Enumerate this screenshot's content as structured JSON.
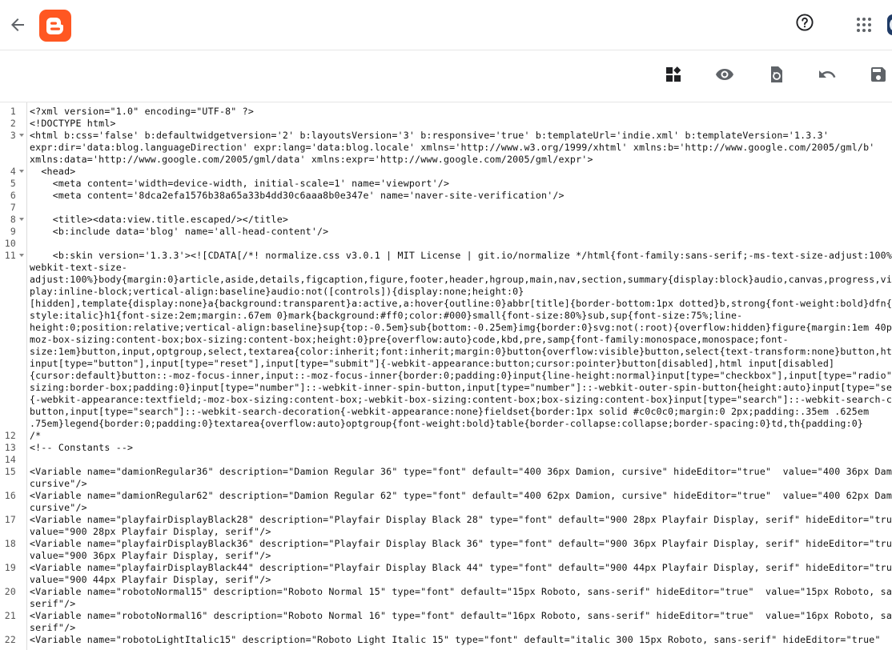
{
  "header": {
    "back_icon": "arrow-left-icon",
    "logo_icon": "blogger-logo",
    "help_icon": "help-circle-icon",
    "apps_icon": "apps-grid-icon",
    "account_icon": "account-avatar"
  },
  "toolbar": {
    "buttons": [
      "widgets-jump-icon",
      "preview-eye-icon",
      "restore-template-icon",
      "undo-icon",
      "save-icon"
    ]
  },
  "colors": {
    "brand": "#ff5722",
    "string": "#a31515",
    "text": "#111111",
    "gutter_text": "#555555"
  },
  "editor": {
    "line_numbers": [
      "1",
      "2",
      "3",
      "",
      "",
      "4",
      "5",
      "6",
      "7",
      "8",
      "9",
      "10",
      "11",
      "",
      "",
      "",
      "",
      "",
      "",
      "",
      "",
      "",
      "",
      "",
      "",
      "",
      "",
      "12",
      "13",
      "14",
      "15",
      "",
      "16",
      "",
      "17",
      "",
      "18",
      "",
      "19",
      "",
      "20",
      "",
      "21",
      "",
      "22"
    ],
    "lines": [
      "<?xml version=\"1.0\" encoding=\"UTF-8\" ?>",
      "<!DOCTYPE html>",
      "<html b:css='false' b:defaultwidgetversion='2' b:layoutsVersion='3' b:responsive='true' b:templateUrl='indie.xml' b:templateVersion='1.3.3'",
      "expr:dir='data:blog.languageDirection' expr:lang='data:blog.locale' xmlns='http://www.w3.org/1999/xhtml' xmlns:b='http://www.google.com/2005/gml/b'",
      "xmlns:data='http://www.google.com/2005/gml/data' xmlns:expr='http://www.google.com/2005/gml/expr'>",
      "  <head>",
      "    <meta content='width=device-width, initial-scale=1' name='viewport'/>",
      "    <meta content='8dca2efa1576b38a65a33b4dd30c6aaa8b0e347e' name='naver-site-verification'/>",
      "",
      "    <title><data:view.title.escaped/></title>",
      "    <b:include data='blog' name='all-head-content'/>",
      "",
      "    <b:skin version='1.3.3'><![CDATA[/*! normalize.css v3.0.1 | MIT License | git.io/normalize */html{font-family:sans-serif;-ms-text-size-adjust:100%;-",
      "webkit-text-size-",
      "adjust:100%}body{margin:0}article,aside,details,figcaption,figure,footer,header,hgroup,main,nav,section,summary{display:block}audio,canvas,progress,video{",
      "play:inline-block;vertical-align:baseline}audio:not([controls]){display:none;height:0}",
      "[hidden],template{display:none}a{background:transparent}a:active,a:hover{outline:0}abbr[title]{border-bottom:1px dotted}b,strong{font-weight:bold}dfn{font",
      "style:italic}h1{font-size:2em;margin:.67em 0}mark{background:#ff0;color:#000}small{font-size:80%}sub,sup{font-size:75%;line-",
      "height:0;position:relative;vertical-align:baseline}sup{top:-0.5em}sub{bottom:-0.25em}img{border:0}svg:not(:root){overflow:hidden}figure{margin:1em 40px}hr",
      "moz-box-sizing:content-box;box-sizing:content-box;height:0}pre{overflow:auto}code,kbd,pre,samp{font-family:monospace,monospace;font-",
      "size:1em}button,input,optgroup,select,textarea{color:inherit;font:inherit;margin:0}button{overflow:visible}button,select{text-transform:none}button,html",
      "input[type=\"button\"],input[type=\"reset\"],input[type=\"submit\"]{-webkit-appearance:button;cursor:pointer}button[disabled],html input[disabled]",
      "{cursor:default}button::-moz-focus-inner,input::-moz-focus-inner{border:0;padding:0}input{line-height:normal}input[type=\"checkbox\"],input[type=\"radio\"]{bo",
      "sizing:border-box;padding:0}input[type=\"number\"]::-webkit-inner-spin-button,input[type=\"number\"]::-webkit-outer-spin-button{height:auto}input[type=\"search",
      "{-webkit-appearance:textfield;-moz-box-sizing:content-box;-webkit-box-sizing:content-box;box-sizing:content-box}input[type=\"search\"]::-webkit-search-cance",
      "button,input[type=\"search\"]::-webkit-search-decoration{-webkit-appearance:none}fieldset{border:1px solid #c0c0c0;margin:0 2px;padding:.35em .625em",
      ".75em}legend{border:0;padding:0}textarea{overflow:auto}optgroup{font-weight:bold}table{border-collapse:collapse;border-spacing:0}td,th{padding:0}",
      "/*",
      "<!-- Constants -->",
      "",
      "<Variable name=\"damionRegular36\" description=\"Damion Regular 36\" type=\"font\" default=\"400 36px Damion, cursive\" hideEditor=\"true\"  value=\"400 36px Damion,",
      "cursive\"/>",
      "<Variable name=\"damionRegular62\" description=\"Damion Regular 62\" type=\"font\" default=\"400 62px Damion, cursive\" hideEditor=\"true\"  value=\"400 62px Damion,",
      "cursive\"/>",
      "<Variable name=\"playfairDisplayBlack28\" description=\"Playfair Display Black 28\" type=\"font\" default=\"900 28px Playfair Display, serif\" hideEditor=\"true\"",
      "value=\"900 28px Playfair Display, serif\"/>",
      "<Variable name=\"playfairDisplayBlack36\" description=\"Playfair Display Black 36\" type=\"font\" default=\"900 36px Playfair Display, serif\" hideEditor=\"true\"",
      "value=\"900 36px Playfair Display, serif\"/>",
      "<Variable name=\"playfairDisplayBlack44\" description=\"Playfair Display Black 44\" type=\"font\" default=\"900 44px Playfair Display, serif\" hideEditor=\"true\"",
      "value=\"900 44px Playfair Display, serif\"/>",
      "<Variable name=\"robotoNormal15\" description=\"Roboto Normal 15\" type=\"font\" default=\"15px Roboto, sans-serif\" hideEditor=\"true\"  value=\"15px Roboto, sans-",
      "serif\"/>",
      "<Variable name=\"robotoNormal16\" description=\"Roboto Normal 16\" type=\"font\" default=\"16px Roboto, sans-serif\" hideEditor=\"true\"  value=\"16px Roboto, sans-",
      "serif\"/>",
      "<Variable name=\"robotoLightItalic15\" description=\"Roboto Light Italic 15\" type=\"font\" default=\"italic 300 15px Roboto, sans-serif\" hideEditor=\"true\""
    ]
  }
}
